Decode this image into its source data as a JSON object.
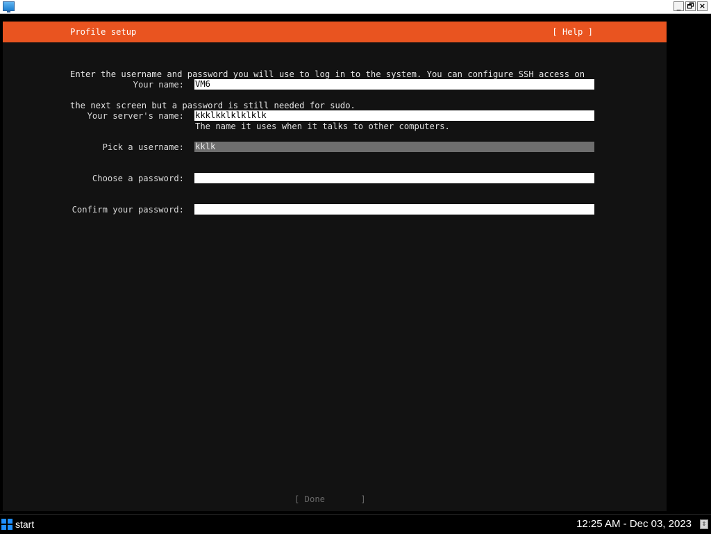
{
  "window": {
    "app_icon": "monitor-icon",
    "controls": {
      "minimize": "_",
      "restore": "🗗",
      "close": "×"
    }
  },
  "installer": {
    "header_title": "Profile setup",
    "help_label": "[ Help ]",
    "intro_line1": "Enter the username and password you will use to log in to the system. You can configure SSH access on",
    "intro_line2": "the next screen but a password is still needed for sudo.",
    "fields": [
      {
        "label": "Your name:",
        "value": "VM6"
      },
      {
        "label": "Your server's name:",
        "value": "kkklkklklklklk",
        "caption": "The name it uses when it talks to other computers."
      },
      {
        "label": "Pick a username:",
        "value": "kklk"
      },
      {
        "label": "Choose a password:",
        "value": ""
      },
      {
        "label": "Confirm your password:",
        "value": ""
      }
    ],
    "done_label": "[ Done       ]",
    "accent_color": "#e95420"
  },
  "taskbar": {
    "start_label": "start",
    "clock": "12:25 AM - Dec 03, 2023",
    "start_icon": "windows-logo-icon",
    "tray_icon": "scroll-arrows-icon"
  }
}
